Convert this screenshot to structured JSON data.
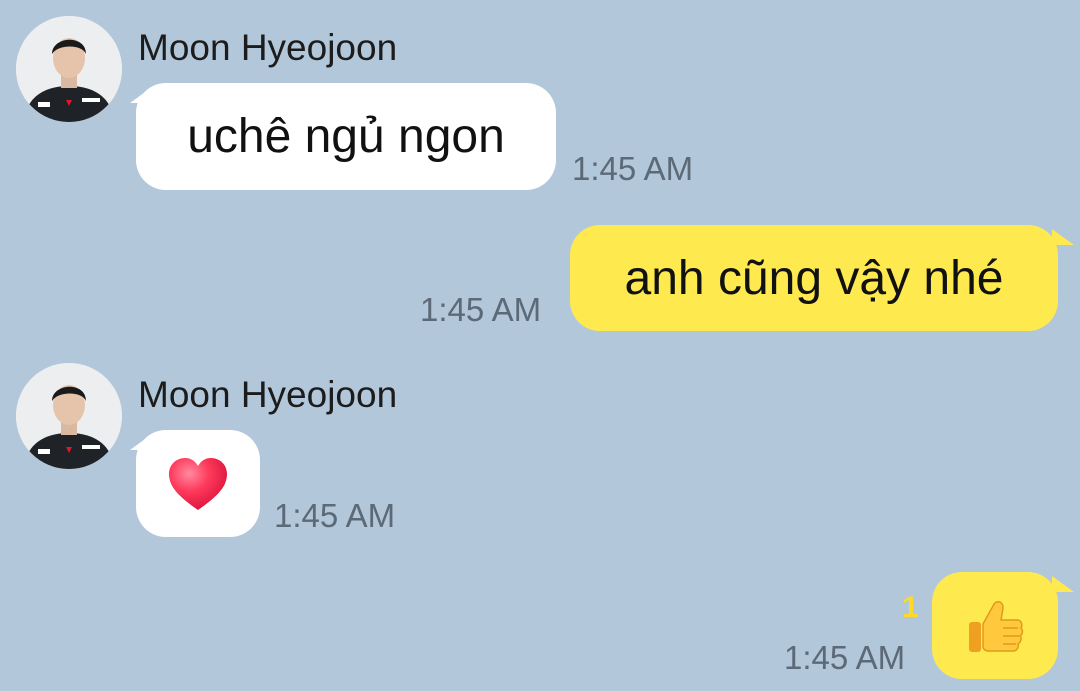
{
  "chat": {
    "colors": {
      "background": "#b2c7da",
      "incoming_bubble": "#ffffff",
      "outgoing_bubble": "#fee94e",
      "unread_counter": "#fcd92b",
      "timestamp": "#5c6a78"
    },
    "messages": [
      {
        "direction": "incoming",
        "sender": "Moon Hyeojoon",
        "avatar_icon": "profile-photo",
        "text": "uchê ngủ ngon",
        "time": "1:45 AM"
      },
      {
        "direction": "outgoing",
        "text": "anh cũng vậy nhé",
        "time": "1:45 AM"
      },
      {
        "direction": "incoming",
        "sender": "Moon Hyeojoon",
        "avatar_icon": "profile-photo",
        "emoji": "red-heart-icon",
        "time": "1:45 AM"
      },
      {
        "direction": "outgoing",
        "emoji": "thumbs-up-icon",
        "unread_count": "1",
        "time": "1:45 AM"
      }
    ]
  }
}
